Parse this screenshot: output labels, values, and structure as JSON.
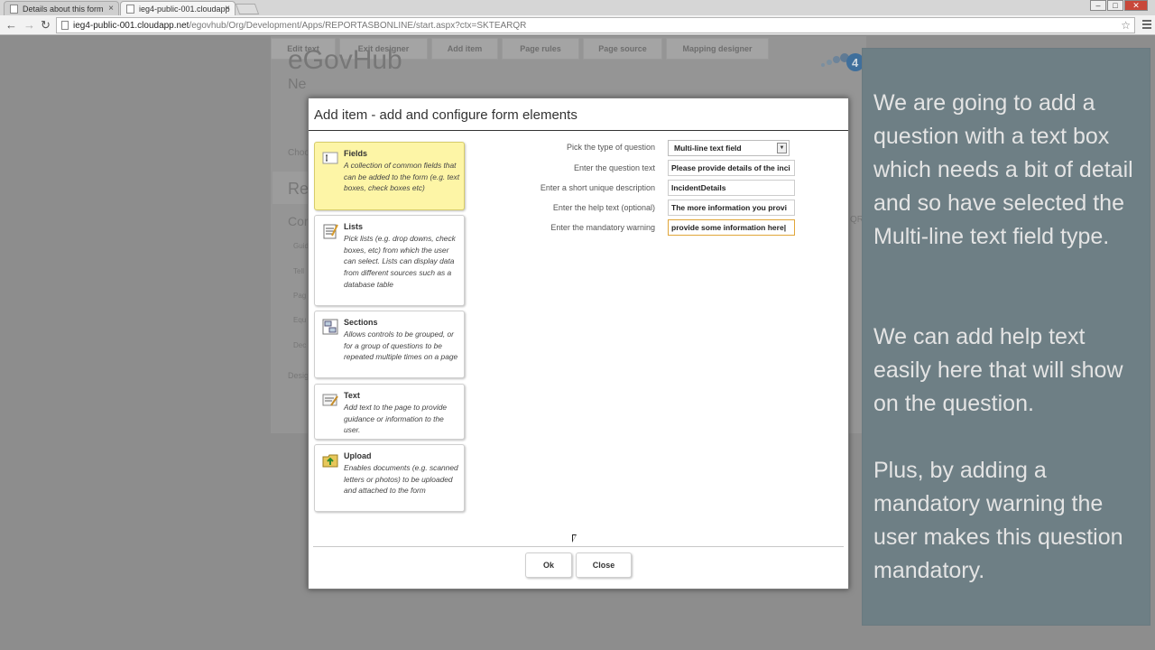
{
  "browser": {
    "tabs": [
      {
        "label": "Details about this form"
      },
      {
        "label": "ieg4-public-001.cloudapp"
      }
    ],
    "url_host": "ieg4-public-001.cloudapp.net",
    "url_path": "/egovhub/Org/Development/Apps/REPORTASBONLINE/start.aspx?ctx=SKTEARQR"
  },
  "designer_tabs": [
    "Edit text",
    "Exit designer",
    "Add item",
    "Page rules",
    "Page source",
    "Mapping designer"
  ],
  "background": {
    "title": "eGovHub",
    "subtitle": "Ne",
    "choose": "Choo",
    "re": "Re",
    "con": "Con",
    "items": [
      "Guid",
      "Tell",
      "Pag",
      "Equ",
      "Dec"
    ],
    "design": "Desig",
    "qr": "QR"
  },
  "overlay": {
    "paragraphs": [
      "We are going to add a question with a text box which needs a bit of detail and so have selected the Multi-line text field type.",
      "We can add help text easily here that will show on the question.",
      "Plus, by adding a mandatory warning the user makes this question mandatory."
    ]
  },
  "modal": {
    "title": "Add item - add and configure form elements",
    "cards": [
      {
        "title": "Fields",
        "desc": "A collection of common fields that can be added to the form (e.g. text boxes, check boxes etc)",
        "icon": "text-field-icon",
        "selected": true
      },
      {
        "title": "Lists",
        "desc": "Pick lists (e.g. drop downs, check boxes, etc) from which the user can select. Lists can display data from different sources such as a database table",
        "icon": "list-icon",
        "selected": false
      },
      {
        "title": "Sections",
        "desc": "Allows controls to be grouped, or for a group of questions to be repeated multiple times on a page",
        "icon": "sections-icon",
        "selected": false
      },
      {
        "title": "Text",
        "desc": "Add text to the page to provide guidance or information to the user.",
        "icon": "text-icon",
        "selected": false
      },
      {
        "title": "Upload",
        "desc": "Enables documents (e.g. scanned letters or photos) to be uploaded and attached to the form",
        "icon": "upload-folder-icon",
        "selected": false
      }
    ],
    "form": {
      "type_label": "Pick the type of question",
      "type_value": "Multi-line text field",
      "question_label": "Enter the question text",
      "question_value": "Please provide details of the inci",
      "desc_label": "Enter a short unique description",
      "desc_value": "IncidentDetails",
      "help_label": "Enter the help text (optional)",
      "help_value": "The more information you provi",
      "mandatory_label": "Enter the mandatory warning",
      "mandatory_value": "provide some information here|"
    },
    "ok_label": "Ok",
    "close_label": "Close"
  }
}
